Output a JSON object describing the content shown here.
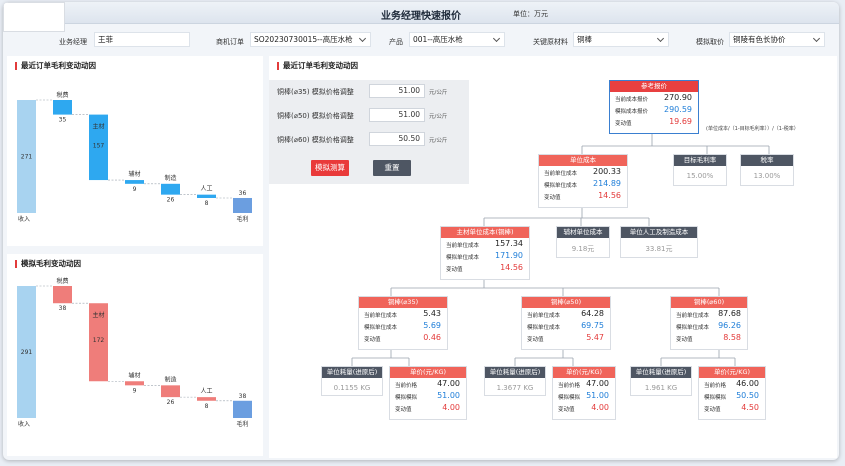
{
  "header": {
    "title": "业务经理快速报价",
    "unit": "单位：万元"
  },
  "filters": [
    {
      "label": "业务经理",
      "value": "王菲",
      "dropdown": false
    },
    {
      "label": "商机订单",
      "value": "SO20230730015--高压水枪",
      "dropdown": true
    },
    {
      "label": "产品",
      "value": "001--高压水枪",
      "dropdown": true
    },
    {
      "label": "关键原材料",
      "value": "铜棒",
      "dropdown": true
    },
    {
      "label": "模拟取价",
      "value": "铜陵有色长协价",
      "dropdown": true
    }
  ],
  "chart1": {
    "title": "最近订单毛利变动动因"
  },
  "chart2": {
    "title": "模拟毛利变动动因"
  },
  "chart_data": [
    {
      "type": "bar",
      "variant": "waterfall",
      "title": "最近订单毛利变动动因",
      "categories": [
        "收入",
        "税费",
        "主材",
        "辅材",
        "制造",
        "人工",
        "毛利"
      ],
      "values": [
        271,
        35,
        157,
        9,
        26,
        8,
        36
      ],
      "bar_labels": [
        "271",
        "35",
        "157",
        "9",
        "26",
        "8",
        "36"
      ],
      "axis_labels": [
        "收入",
        "毛利"
      ],
      "colors": [
        "#a8d3f0",
        "#2ea8f0",
        "#2ea8f0",
        "#2ea8f0",
        "#2ea8f0",
        "#2ea8f0",
        "#6b9ee0"
      ]
    },
    {
      "type": "bar",
      "variant": "waterfall",
      "title": "模拟毛利变动动因",
      "categories": [
        "收入",
        "税费",
        "主材",
        "辅材",
        "制造",
        "人工",
        "毛利"
      ],
      "values": [
        291,
        38,
        172,
        9,
        26,
        8,
        38
      ],
      "bar_labels": [
        "291",
        "38",
        "172",
        "9",
        "26",
        "8",
        "38"
      ],
      "axis_labels": [
        "收入",
        "毛利"
      ],
      "colors": [
        "#a8d3f0",
        "#ef7d7a",
        "#ef7d7a",
        "#ef7d7a",
        "#ef7d7a",
        "#ef7d7a",
        "#6b9ee0"
      ]
    }
  ],
  "sim": {
    "title": "最近订单毛利变动动因",
    "rows": [
      {
        "label": "铜棒(⌀35)   模拟价格调整",
        "value": "51.00",
        "unit": "元/公斤"
      },
      {
        "label": "铜棒(⌀50)   模拟价格调整",
        "value": "51.00",
        "unit": "元/公斤"
      },
      {
        "label": "铜棒(⌀60)   模拟价格调整",
        "value": "50.50",
        "unit": "元/公斤"
      }
    ],
    "simulate_label": "模拟测算",
    "reset_label": "重置"
  },
  "tree": {
    "ref": {
      "title": "参考报价",
      "rows": [
        {
          "k": "当前成本报价",
          "v": "270.90"
        },
        {
          "k": "模拟成本报价",
          "v": "290.59"
        },
        {
          "k": "变动值",
          "v": "19.69"
        }
      ]
    },
    "formula": "(单位成本/（1-目标毛利率））/（1-税率）",
    "unitcost": {
      "title": "单位成本",
      "rows": [
        {
          "k": "当前单位成本",
          "v": "200.33"
        },
        {
          "k": "模拟单位成本",
          "v": "214.89"
        },
        {
          "k": "变动值",
          "v": "14.56"
        }
      ]
    },
    "margin": {
      "title": "目标毛利率",
      "v": "15.00%"
    },
    "tax": {
      "title": "税率",
      "v": "13.00%"
    },
    "main": {
      "title": "主材单位成本(铜棒)",
      "rows": [
        {
          "k": "当前单位成本",
          "v": "157.34"
        },
        {
          "k": "模拟单位成本",
          "v": "171.90"
        },
        {
          "k": "变动值",
          "v": "14.56"
        }
      ]
    },
    "aux": {
      "title": "辅材单位成本",
      "v": "9.18元"
    },
    "labor": {
      "title": "单位人工及制造成本",
      "v": "33.81元"
    },
    "rods": [
      {
        "title": "铜棒(⌀35)",
        "rows": [
          {
            "k": "当前单位成本",
            "v": "5.43"
          },
          {
            "k": "模拟单位成本",
            "v": "5.69"
          },
          {
            "k": "变动值",
            "v": "0.46"
          }
        ],
        "cons": {
          "title": "单位耗量(进原后)",
          "v": "0.1155 KG"
        },
        "price": {
          "title": "单价(元/KG)",
          "rows": [
            {
              "k": "当前价格",
              "v": "47.00"
            },
            {
              "k": "模拟模拟",
              "v": "51.00"
            },
            {
              "k": "变动值",
              "v": "4.00"
            }
          ]
        }
      },
      {
        "title": "铜棒(⌀50)",
        "rows": [
          {
            "k": "当前单位成本",
            "v": "64.28"
          },
          {
            "k": "模拟单位成本",
            "v": "69.75"
          },
          {
            "k": "变动值",
            "v": "5.47"
          }
        ],
        "cons": {
          "title": "单位耗量(进原后)",
          "v": "1.3677 KG"
        },
        "price": {
          "title": "单价(元/KG)",
          "rows": [
            {
              "k": "当前价格",
              "v": "47.00"
            },
            {
              "k": "模拟模拟",
              "v": "51.00"
            },
            {
              "k": "变动值",
              "v": "4.00"
            }
          ]
        }
      },
      {
        "title": "铜棒(⌀60)",
        "rows": [
          {
            "k": "当前单位成本",
            "v": "87.68"
          },
          {
            "k": "模拟单位成本",
            "v": "96.26"
          },
          {
            "k": "变动值",
            "v": "8.58"
          }
        ],
        "cons": {
          "title": "单位耗量(进原后)",
          "v": "1.961 KG"
        },
        "price": {
          "title": "单价(元/KG)",
          "rows": [
            {
              "k": "当前价格",
              "v": "46.00"
            },
            {
              "k": "模拟模拟",
              "v": "50.50"
            },
            {
              "k": "变动值",
              "v": "4.50"
            }
          ]
        }
      }
    ]
  }
}
